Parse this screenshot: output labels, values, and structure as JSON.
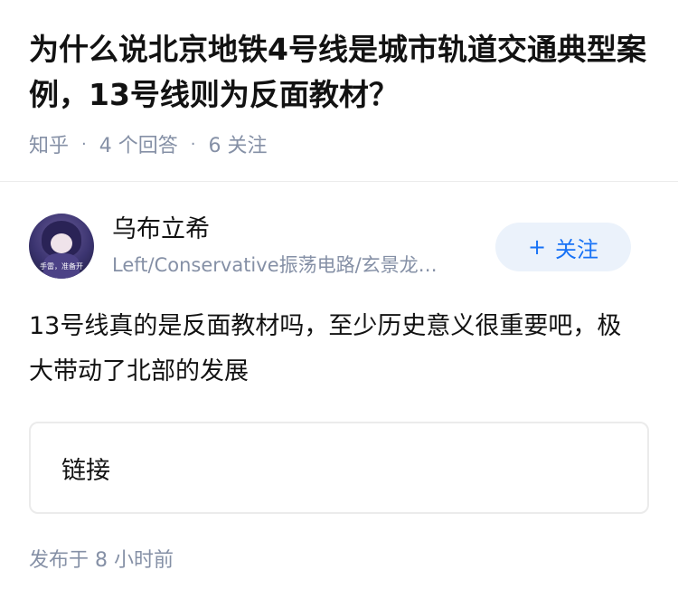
{
  "question": {
    "title": "为什么说北京地铁4号线是城市轨道交通典型案例，13号线则为反面教材？",
    "source": "知乎",
    "answers_count": "4 个回答",
    "followers_count": "6 关注",
    "separator": "·"
  },
  "author": {
    "name": "乌布立希",
    "bio": "Left/Conservative振荡电路/玄景龙…",
    "avatar_caption": "手雷，准备开"
  },
  "follow_button": {
    "icon": "+",
    "label": "关注"
  },
  "answer": {
    "text": "13号线真的是反面教材吗，至少历史意义很重要吧，极大带动了北部的发展",
    "link_label": "链接",
    "publish_time": "发布于 8 小时前"
  },
  "colors": {
    "text": "#121212",
    "meta": "#8590a6",
    "accent": "#1772f6",
    "button_bg": "#ebf2fb",
    "border": "#ebebeb"
  }
}
